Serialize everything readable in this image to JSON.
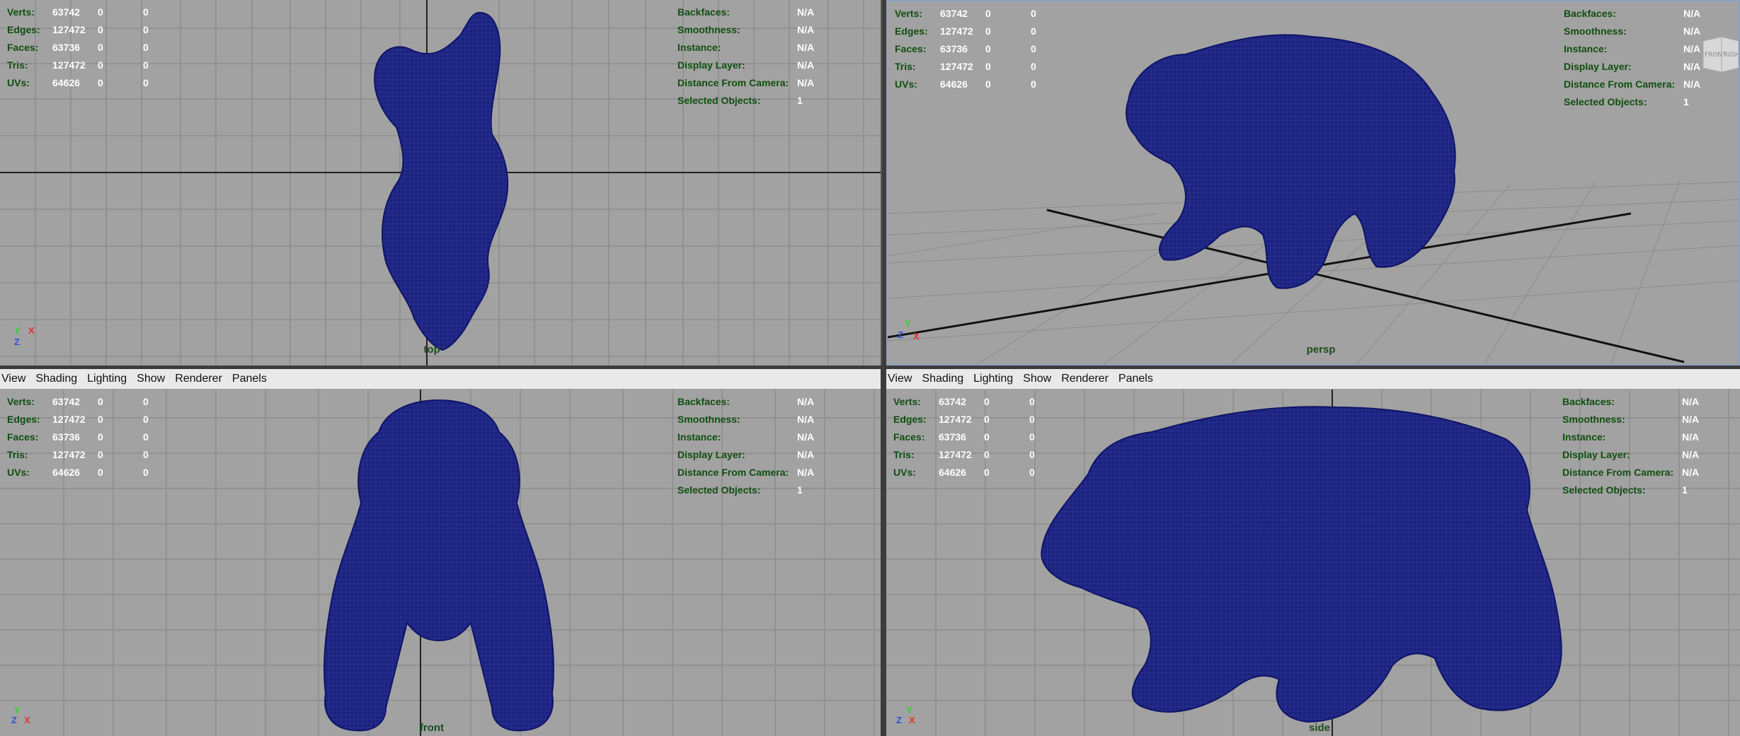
{
  "menu": [
    "View",
    "Shading",
    "Lighting",
    "Show",
    "Renderer",
    "Panels"
  ],
  "hud_left": {
    "rows": [
      {
        "label": "Verts:",
        "v1": "63742",
        "v2": "0",
        "v3": "0"
      },
      {
        "label": "Edges:",
        "v1": "127472",
        "v2": "0",
        "v3": "0"
      },
      {
        "label": "Faces:",
        "v1": "63736",
        "v2": "0",
        "v3": "0"
      },
      {
        "label": "Tris:",
        "v1": "127472",
        "v2": "0",
        "v3": "0"
      },
      {
        "label": "UVs:",
        "v1": "64626",
        "v2": "0",
        "v3": "0"
      }
    ]
  },
  "hud_right": {
    "rows": [
      {
        "label": "Backfaces:",
        "value": "N/A"
      },
      {
        "label": "Smoothness:",
        "value": "N/A"
      },
      {
        "label": "Instance:",
        "value": "N/A"
      },
      {
        "label": "Display Layer:",
        "value": "N/A"
      },
      {
        "label": "Distance From Camera:",
        "value": "N/A"
      },
      {
        "label": "Selected Objects:",
        "value": "1"
      }
    ]
  },
  "viewports": {
    "top": {
      "camera": "top"
    },
    "persp": {
      "camera": "persp"
    },
    "front": {
      "camera": "front"
    },
    "side": {
      "camera": "side"
    }
  },
  "viewcube": {
    "front": "FRONT",
    "right": "RIGHT"
  },
  "gizmo": {
    "x": "X",
    "y": "Y",
    "z": "Z"
  },
  "colors": {
    "background": "#a2a2a2",
    "grid": "#8c8c8c",
    "mesh": "#1a1f7a",
    "hud_label": "#0f4f0f",
    "axis_x": "#e03030",
    "axis_y": "#30d030",
    "axis_z": "#3050e0"
  }
}
